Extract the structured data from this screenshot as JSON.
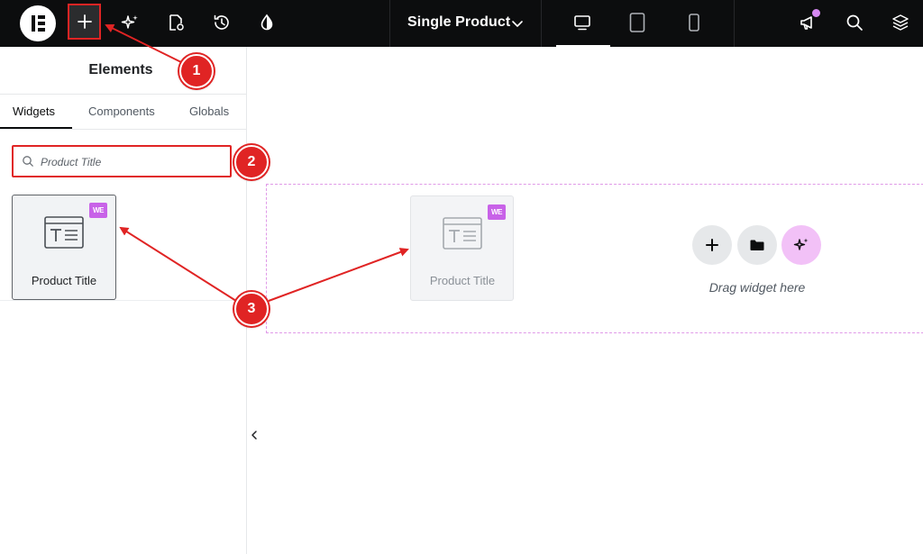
{
  "topbar": {
    "logo_icon": "elementor-logo-icon",
    "add_icon": "plus-icon",
    "ai_icon": "sparkle-icon",
    "page_settings_icon": "page-settings-icon",
    "history_icon": "history-icon",
    "site_settings_icon": "droplet-icon",
    "document_title": "Single Product",
    "document_chevron_icon": "chevron-down-icon",
    "devices": [
      {
        "name": "desktop",
        "icon": "desktop-icon",
        "active": true
      },
      {
        "name": "tablet",
        "icon": "tablet-icon",
        "active": false
      },
      {
        "name": "mobile",
        "icon": "mobile-icon",
        "active": false
      }
    ],
    "notifications_icon": "megaphone-icon",
    "search_icon": "search-icon",
    "structure_icon": "layers-icon"
  },
  "panel": {
    "title": "Elements",
    "tabs": [
      {
        "label": "Widgets",
        "active": true
      },
      {
        "label": "Components",
        "active": false
      },
      {
        "label": "Globals",
        "active": false
      }
    ],
    "search": {
      "value": "Product Title",
      "placeholder": "Product Title"
    },
    "widgets": [
      {
        "label": "Product Title",
        "icon": "product-title-icon",
        "badge": "WE"
      }
    ]
  },
  "canvas": {
    "dragging_widget": {
      "label": "Product Title",
      "badge": "WE"
    },
    "drop_zone": {
      "hint": "Drag widget here",
      "buttons": [
        {
          "name": "add-section",
          "icon": "plus-icon"
        },
        {
          "name": "add-template",
          "icon": "folder-icon"
        },
        {
          "name": "ai-generate",
          "icon": "sparkle-icon"
        }
      ]
    }
  },
  "annotations": [
    "1",
    "2",
    "3"
  ],
  "colors": {
    "topbar_bg": "#0c0d0e",
    "annotation_red": "#e02424",
    "pro_badge": "#c862e8",
    "ai_button_bg": "#f2c1f7",
    "dropzone_border": "#e09ae8"
  }
}
